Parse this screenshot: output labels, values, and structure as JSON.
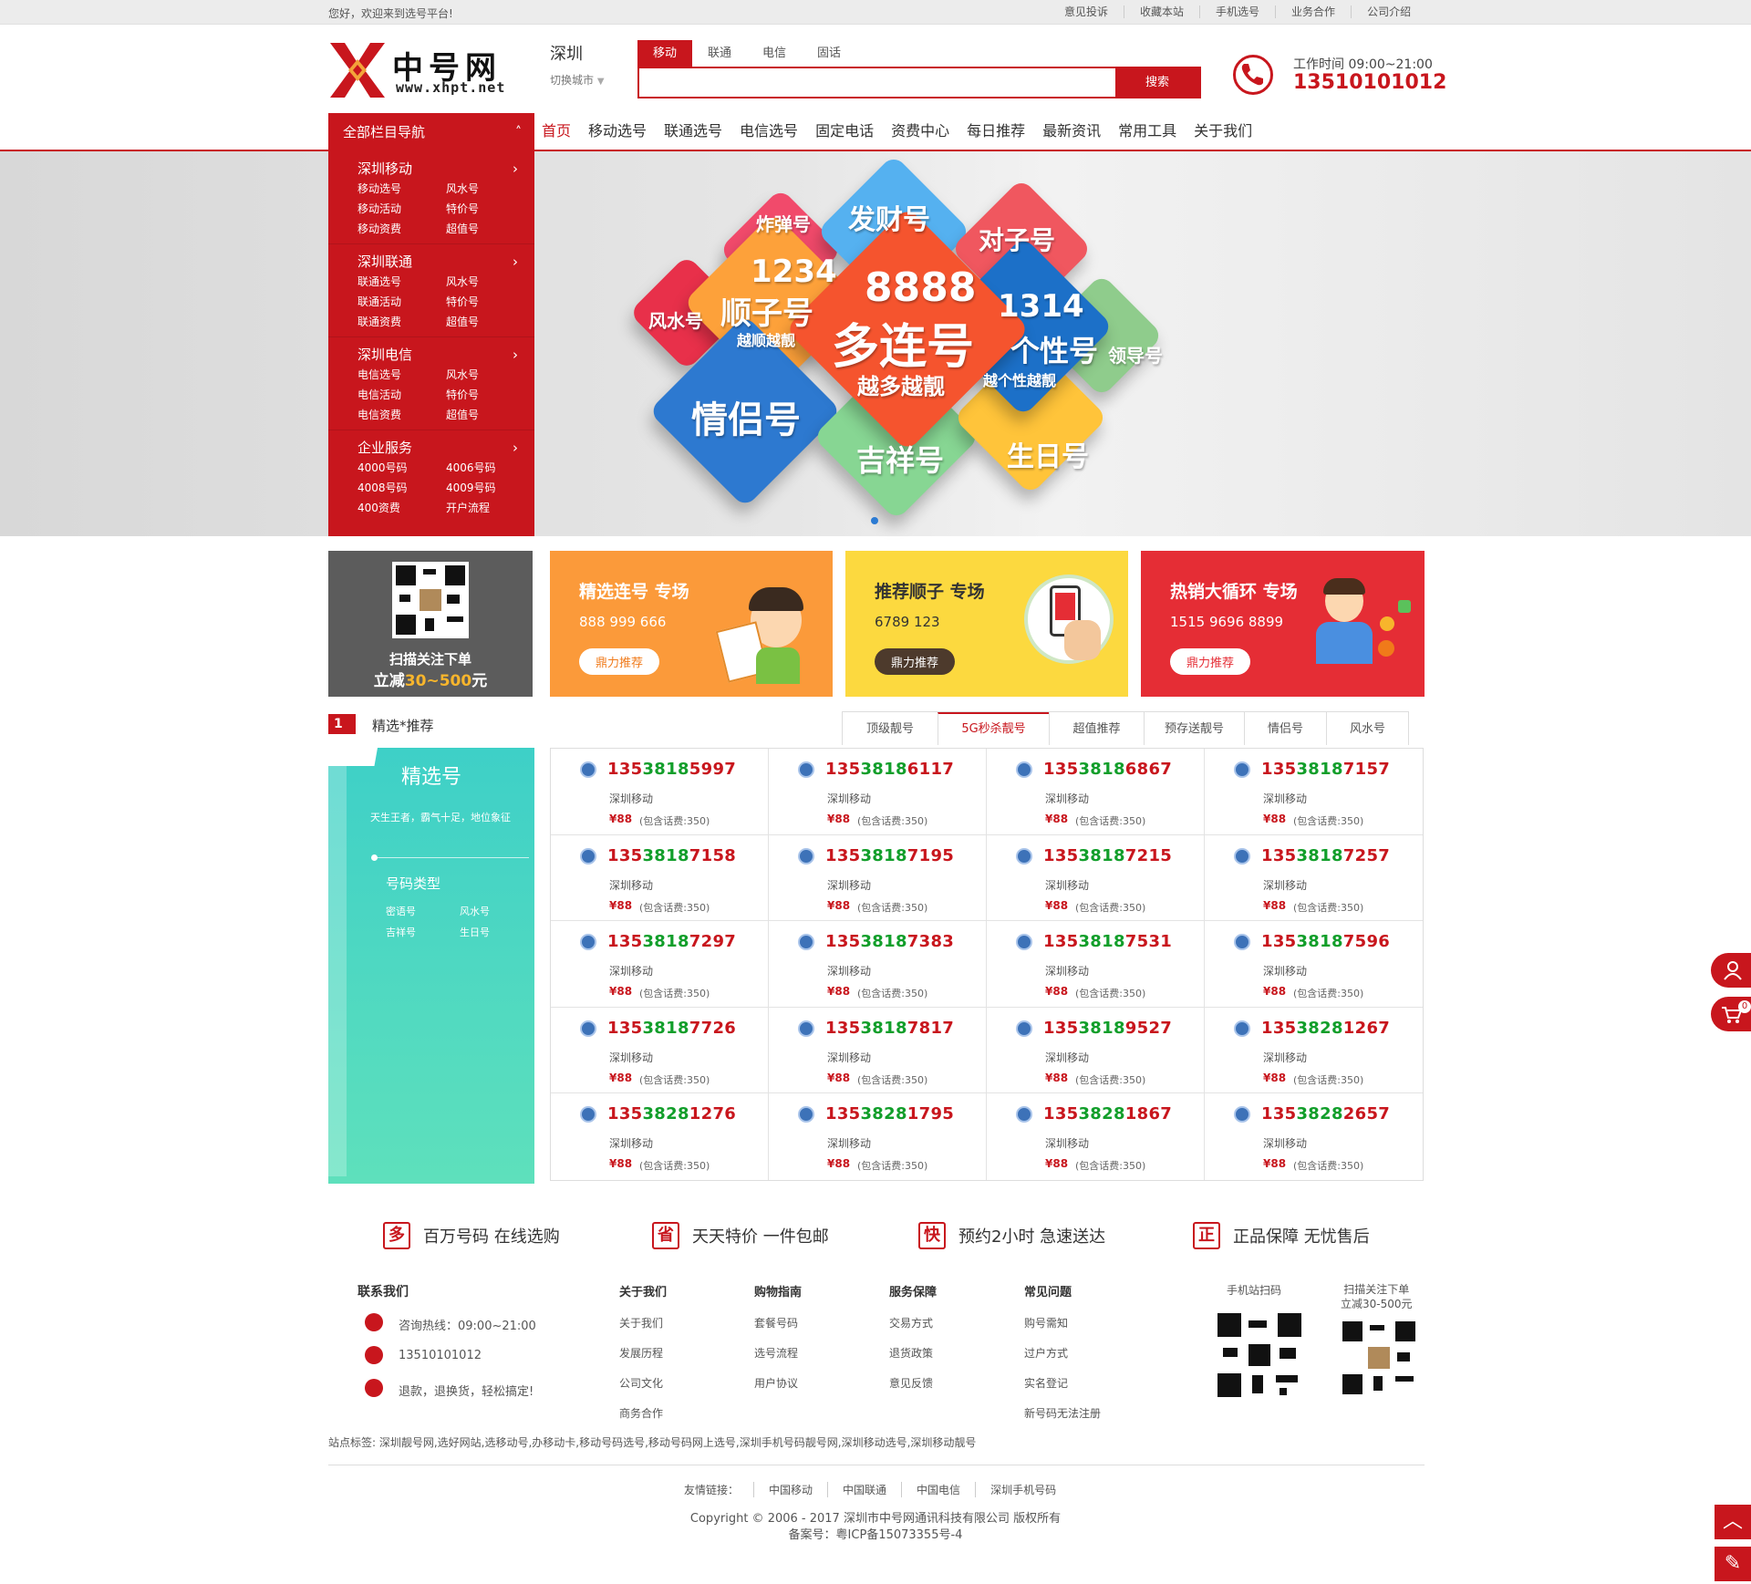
{
  "topbar": {
    "welcome": "您好，欢迎来到选号平台!",
    "links": [
      "意见投诉",
      "收藏本站",
      "手机选号",
      "业务合作",
      "公司介绍"
    ]
  },
  "header": {
    "logo_cn": "中号网",
    "logo_en": "www.xhpt.net",
    "city": "深圳",
    "city_switch": "切换城市",
    "search_tabs": [
      "移动",
      "联通",
      "电信",
      "固话"
    ],
    "search_button": "搜索",
    "work_hours": "工作时间 09:00~21:00",
    "phone": "13510101012"
  },
  "nav": {
    "all_label": "全部栏目导航",
    "items": [
      "首页",
      "移动选号",
      "联通选号",
      "电信选号",
      "固定电话",
      "资费中心",
      "每日推荐",
      "最新资讯",
      "常用工具",
      "关于我们"
    ]
  },
  "sidemenu": [
    {
      "title": "深圳移动",
      "items": [
        "移动选号",
        "风水号",
        "移动活动",
        "特价号",
        "移动资费",
        "超值号"
      ]
    },
    {
      "title": "深圳联通",
      "items": [
        "联通选号",
        "风水号",
        "联通活动",
        "特价号",
        "联通资费",
        "超值号"
      ]
    },
    {
      "title": "深圳电信",
      "items": [
        "电信选号",
        "风水号",
        "电信活动",
        "特价号",
        "电信资费",
        "超值号"
      ]
    },
    {
      "title": "企业服务",
      "items": [
        "4000号码",
        "4006号码",
        "4008号码",
        "4009号码",
        "400资费",
        "开户流程"
      ]
    }
  ],
  "banner": {
    "cubes": [
      "炸弹号",
      "发财号",
      "对子号",
      "1234",
      "顺子号",
      "越顺越靓",
      "8888",
      "多连号",
      "越多越靓",
      "1314",
      "个性号",
      "越个性越靓",
      "风水号",
      "领导号",
      "情侣号",
      "吉祥号",
      "生日号"
    ]
  },
  "promos": {
    "qr": {
      "line1": "扫描关注下单",
      "line2_a": "立减",
      "line2_b": "30~500",
      "line2_c": "元"
    },
    "cards": [
      {
        "title": "精选连号 专场",
        "nums": "888 999 666",
        "btn": "鼎力推荐",
        "color": "#fb9a3a",
        "btncolor": "#f07a1a"
      },
      {
        "title": "推荐顺子 专场",
        "nums": "6789 123",
        "btn": "鼎力推荐",
        "color": "#fcd93f",
        "btncolor": "#fff"
      },
      {
        "title": "热销大循环 专场",
        "nums": "1515 9696 8899",
        "btn": "鼎力推荐",
        "color": "#e52d35",
        "btncolor": "#e52d35"
      }
    ]
  },
  "section": {
    "num": "1",
    "title": "精选*推荐",
    "tabs": [
      "顶级靓号",
      "5G秒杀靓号",
      "超值推荐",
      "预存送靓号",
      "情侣号",
      "风水号"
    ],
    "side": {
      "title": "精选号",
      "sub": "天生王者，霸气十足，地位象征",
      "type_title": "号码类型",
      "types": [
        "密语号",
        "风水号",
        "吉祥号",
        "生日号"
      ]
    },
    "operator": "深圳移动",
    "price": "¥88",
    "include": "(包含话费:350)",
    "numbers": [
      [
        "1353818",
        "5997"
      ],
      [
        "1353818",
        "6117"
      ],
      [
        "1353818",
        "6867"
      ],
      [
        "1353818",
        "7157"
      ],
      [
        "1353818",
        "7158"
      ],
      [
        "1353818",
        "7195"
      ],
      [
        "1353818",
        "7215"
      ],
      [
        "1353818",
        "7257"
      ],
      [
        "1353818",
        "7297"
      ],
      [
        "1353818",
        "7383"
      ],
      [
        "1353818",
        "7531"
      ],
      [
        "1353818",
        "7596"
      ],
      [
        "1353818",
        "7726"
      ],
      [
        "1353818",
        "7817"
      ],
      [
        "1353818",
        "9527"
      ],
      [
        "1353828",
        "1267"
      ],
      [
        "1353828",
        "1276"
      ],
      [
        "1353828",
        "1795"
      ],
      [
        "1353828",
        "1867"
      ],
      [
        "1353828",
        "2657"
      ]
    ]
  },
  "features": [
    {
      "icon": "多",
      "text": "百万号码 在线选购"
    },
    {
      "icon": "省",
      "text": "天天特价 一件包邮"
    },
    {
      "icon": "快",
      "text": "预约2小时 急速送达"
    },
    {
      "icon": "正",
      "text": "正品保障 无忧售后"
    }
  ],
  "footer": {
    "contact_title": "联系我们",
    "contact": [
      "咨询热线：09:00~21:00",
      "13510101012",
      "退款，退换货，轻松搞定!"
    ],
    "cols": [
      {
        "title": "关于我们",
        "items": [
          "关于我们",
          "发展历程",
          "公司文化",
          "商务合作"
        ]
      },
      {
        "title": "购物指南",
        "items": [
          "套餐号码",
          "选号流程",
          "用户协议"
        ]
      },
      {
        "title": "服务保障",
        "items": [
          "交易方式",
          "退货政策",
          "意见反馈"
        ]
      },
      {
        "title": "常见问题",
        "items": [
          "购号需知",
          "过户方式",
          "实名登记",
          "新号码无法注册"
        ]
      }
    ],
    "qr1": "手机站扫码",
    "qr2_l1": "扫描关注下单",
    "qr2_l2": "立减30-500元",
    "tags": "站点标签:   深圳靓号网,选好网站,选移动号,办移动卡,移动号码选号,移动号码网上选号,深圳手机号码靓号网,深圳移动选号,深圳移动靓号",
    "friends_label": "友情链接：",
    "friends": [
      "中国移动",
      "中国联通",
      "中国电信",
      "深圳手机号码"
    ],
    "copyright": "Copyright © 2006 - 2017 深圳市中号网通讯科技有限公司 版权所有",
    "icp": "备案号：粤ICP备15073355号-4"
  },
  "float": {
    "cart_count": "0"
  }
}
